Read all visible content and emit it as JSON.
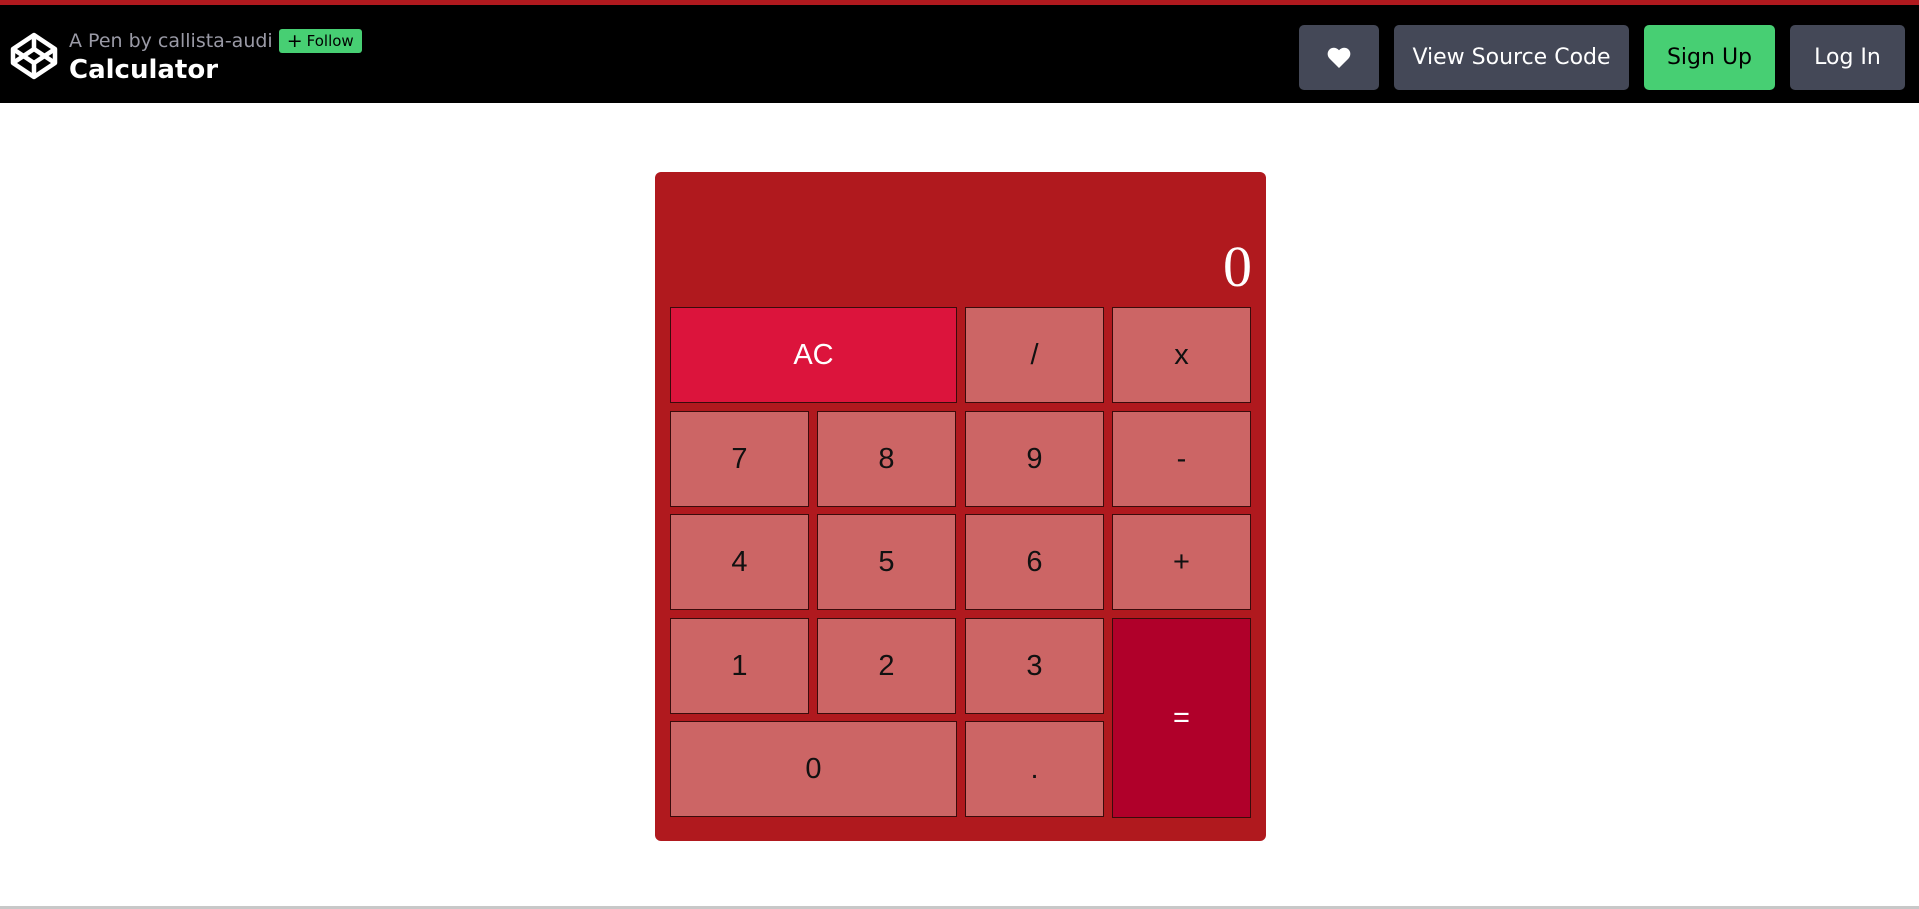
{
  "header": {
    "byline_prefix": "A Pen by",
    "author": "callista-audi",
    "follow_label": "Follow",
    "title": "Calculator",
    "buttons": {
      "heart_icon": "heart-icon",
      "view_source": "View Source Code",
      "sign_up": "Sign Up",
      "log_in": "Log In"
    }
  },
  "calculator": {
    "display": "0",
    "keys": {
      "ac": "AC",
      "divide": "/",
      "multiply": "x",
      "seven": "7",
      "eight": "8",
      "nine": "9",
      "subtract": "-",
      "four": "4",
      "five": "5",
      "six": "6",
      "add": "+",
      "one": "1",
      "two": "2",
      "three": "3",
      "equals": "=",
      "zero": "0",
      "decimal": "."
    }
  },
  "colors": {
    "header_bg": "#000000",
    "calculator_bg": "#b0191e",
    "key_bg": "#cc6565",
    "ac_bg": "#dc143c",
    "equals_bg": "#b0002a",
    "follow_bg": "#47cf73",
    "header_button_bg": "#444857"
  }
}
